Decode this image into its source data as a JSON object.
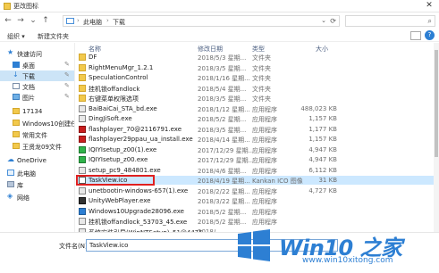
{
  "window": {
    "title": "更改图标",
    "close_glyph": "✕"
  },
  "nav": {
    "back_glyph": "←",
    "forward_glyph": "→",
    "dropdown_glyph": "⌄",
    "up_glyph": "↑",
    "breadcrumb": [
      "此电脑",
      "下载"
    ],
    "breadcrumb_sep": "›",
    "refresh_glyph": "⟳",
    "search_glyph": "⌕"
  },
  "toolbar": {
    "organize": "组织 ▾",
    "new_folder": "新建文件夹",
    "help": "?"
  },
  "sidebar": {
    "items": [
      {
        "label": "快速访问",
        "icon": "star-icon",
        "indent": 0,
        "pinned": false
      },
      {
        "label": "桌面",
        "icon": "desktop-icon",
        "indent": 1,
        "pinned": true
      },
      {
        "label": "下载",
        "icon": "download-icon",
        "indent": 1,
        "pinned": true,
        "selected": true
      },
      {
        "label": "文档",
        "icon": "document-icon",
        "indent": 1,
        "pinned": true
      },
      {
        "label": "图片",
        "icon": "picture-icon",
        "indent": 1,
        "pinned": true
      },
      {
        "label": "17134",
        "icon": "folder-icon",
        "indent": 1,
        "pinned": false
      },
      {
        "label": "Windows10创建任",
        "icon": "folder-icon",
        "indent": 1,
        "pinned": false
      },
      {
        "label": "常用文件",
        "icon": "folder-icon",
        "indent": 1,
        "pinned": false
      },
      {
        "label": "王贤龙09文件",
        "icon": "folder-icon",
        "indent": 1,
        "pinned": false
      },
      {
        "label": "OneDrive",
        "icon": "onedrive-icon",
        "indent": 0,
        "pinned": false
      },
      {
        "label": "此电脑",
        "icon": "pc-icon",
        "indent": 0,
        "pinned": false
      },
      {
        "label": "库",
        "icon": "library-icon",
        "indent": 0,
        "pinned": false
      },
      {
        "label": "网络",
        "icon": "network-icon",
        "indent": 0,
        "pinned": false
      }
    ]
  },
  "columns": {
    "name": "名称",
    "date": "修改日期",
    "type": "类型",
    "size": "大小",
    "sort_glyph": "^"
  },
  "files": [
    {
      "name": "DF",
      "date": "2018/5/3 星期...",
      "type": "文件夹",
      "size": "",
      "icon": "folder-icon"
    },
    {
      "name": "RightMenuMgr_1.2.1",
      "date": "2018/3/5 星期...",
      "type": "文件夹",
      "size": "",
      "icon": "folder-icon"
    },
    {
      "name": "SpeculationControl",
      "date": "2018/1/16 星期...",
      "type": "文件夹",
      "size": "",
      "icon": "folder-icon"
    },
    {
      "name": "挂机锁offandlock",
      "date": "2018/5/4 星期...",
      "type": "文件夹",
      "size": "",
      "icon": "folder-icon"
    },
    {
      "name": "右键菜单权限选项",
      "date": "2018/3/5 星期...",
      "type": "文件夹",
      "size": "",
      "icon": "folder-icon"
    },
    {
      "name": "BaiBaiCai_STA_bd.exe",
      "date": "2018/1/12 星期...",
      "type": "应用程序",
      "size": "488,023 KB",
      "icon": "exe-icon"
    },
    {
      "name": "DingJiSoft.exe",
      "date": "2018/5/2 星期...",
      "type": "应用程序",
      "size": "1,157 KB",
      "icon": "exe-icon"
    },
    {
      "name": "flashplayer_70@2116791.exe",
      "date": "2018/3/5 星期...",
      "type": "应用程序",
      "size": "1,177 KB",
      "icon": "flash-icon"
    },
    {
      "name": "flashplayer29ppau_ua_install.exe",
      "date": "2018/4/14 星期...",
      "type": "应用程序",
      "size": "1,157 KB",
      "icon": "flash-icon"
    },
    {
      "name": "IQIYIsetup_z00(1).exe",
      "date": "2017/12/29 星期...",
      "type": "应用程序",
      "size": "4,947 KB",
      "icon": "iqiyi-icon"
    },
    {
      "name": "IQIYIsetup_z00.exe",
      "date": "2017/12/29 星期...",
      "type": "应用程序",
      "size": "4,947 KB",
      "icon": "iqiyi-icon"
    },
    {
      "name": "setup_pc9_484801.exe",
      "date": "2018/4/6 星期...",
      "type": "应用程序",
      "size": "6,112 KB",
      "icon": "exe-icon"
    },
    {
      "name": "TaskView.ico",
      "date": "2018/4/19 星期...",
      "type": "Kankan ICO 图像",
      "size": "31 KB",
      "icon": "ico-file-icon",
      "selected": true
    },
    {
      "name": "unetbootin-windows-657(1).exe",
      "date": "2018/2/22 星期...",
      "type": "应用程序",
      "size": "4,727 KB",
      "icon": "exe-icon"
    },
    {
      "name": "UnityWebPlayer.exe",
      "date": "2018/3/22 星期...",
      "type": "应用程序",
      "size": "",
      "icon": "unity-icon"
    },
    {
      "name": "Windows10Upgrade28096.exe",
      "date": "2018/5/2 星期...",
      "type": "应用程序",
      "size": "",
      "icon": "windows-icon"
    },
    {
      "name": "挂机锁offandlock_53703_45.exe",
      "date": "2018/5/2 星期...",
      "type": "应用程序",
      "size": "",
      "icon": "exe-icon"
    },
    {
      "name": "系统安装引导(WinNTSetup)_51@4475...",
      "date": "2018/...",
      "type": "",
      "size": "",
      "icon": "exe-icon"
    }
  ],
  "bottom": {
    "filename_label": "文件名(N):",
    "filename_value": "TaskView.ico"
  },
  "watermark": {
    "brand": "Win10 之家",
    "url": "www.win10xitong.com"
  },
  "colors": {
    "accent": "#2d7fd3",
    "selection": "#cce8ff",
    "highlight_border": "#e02020",
    "folder": "#f2c94c"
  }
}
